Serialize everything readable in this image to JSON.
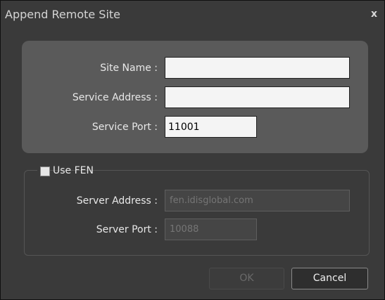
{
  "dialog": {
    "title": "Append Remote Site",
    "close_label": "x"
  },
  "form": {
    "site_name_label": "Site Name :",
    "site_name_value": "",
    "service_address_label": "Service Address :",
    "service_address_value": "",
    "service_port_label": "Service Port :",
    "service_port_value": "11001"
  },
  "fen": {
    "checkbox_label": "Use FEN",
    "checked": false,
    "server_address_label": "Server Address :",
    "server_address_placeholder": "fen.idisglobal.com",
    "server_port_label": "Server Port :",
    "server_port_placeholder": "10088"
  },
  "buttons": {
    "ok_label": "OK",
    "cancel_label": "Cancel"
  },
  "colors": {
    "background": "#3a3a3a",
    "panel": "#5a5a5a",
    "input_bg": "#f4f4f4",
    "disabled_input_bg": "#454545"
  }
}
